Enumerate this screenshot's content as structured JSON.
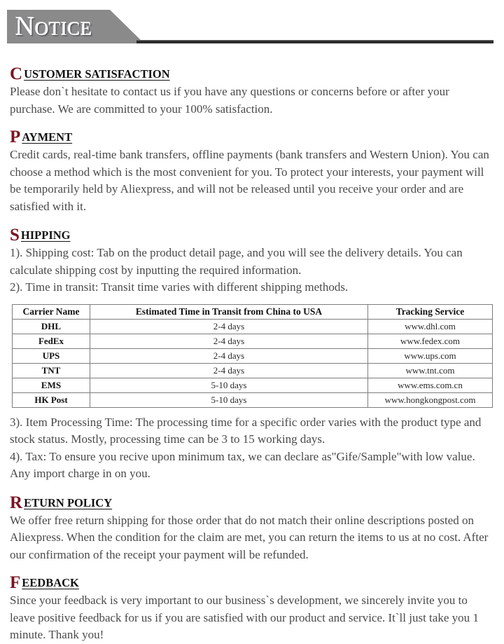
{
  "banner": {
    "title": "Notice"
  },
  "sections": [
    {
      "id": "customer-satisfaction",
      "dropcap": "C",
      "heading_rest": "USTOMER SATISFACTION ",
      "paragraphs": [
        "Please don`t hesitate to contact us if you have any questions or concerns before or after your purchase. We are committed to your 100% satisfaction."
      ]
    },
    {
      "id": "payment",
      "dropcap": "P",
      "heading_rest": "AYMENT",
      "paragraphs": [
        "Credit cards, real-time bank transfers, offline payments (bank transfers and Western Union). You can choose a method which is the most convenient for you. To protect your interests, your payment will be temporarily held by Aliexpress, and will not be released until you receive your order and are satisfied with it."
      ]
    },
    {
      "id": "shipping",
      "dropcap": "S",
      "heading_rest": "HIPPING",
      "paragraphs_before_table": [
        "1). Shipping cost:  Tab on the product detail page, and you will see the delivery details. You can calculate shipping cost by inputting the required information.",
        "2). Time in transit: Transit time varies with different shipping methods."
      ],
      "paragraphs_after_table": [
        "3). Item Processing Time: The processing time for a specific order varies with the product type and stock status. Mostly, processing time can be 3 to 15 working days.",
        "4). Tax: To ensure you recive upon minimum tax, we can declare as\"Gife/Sample\"with low value. Any import charge in on you."
      ]
    },
    {
      "id": "return-policy",
      "dropcap": "R",
      "heading_rest": "ETURN POLICY",
      "paragraphs": [
        "We offer free return shipping for those order that do not match their online descriptions posted on Aliexpress. When the condition for the claim are met, you can return the items to us at no cost. After our confirmation of the receipt your payment will be refunded."
      ]
    },
    {
      "id": "feedback",
      "dropcap": "F",
      "heading_rest": "EEDBACK",
      "paragraphs": [
        "Since your feedback is very important to our business`s development, we sincerely invite you to leave positive feedback for us if you are satisfied with our product and service. It`ll just take you 1 minute. Thank you!"
      ]
    }
  ],
  "shipping_table": {
    "headers": [
      "Carrier Name",
      "Estimated Time in Transit from China to USA",
      "Tracking Service"
    ],
    "rows": [
      {
        "carrier": "DHL",
        "transit": "2-4 days",
        "tracking": "www.dhl.com"
      },
      {
        "carrier": "FedEx",
        "transit": "2-4 days",
        "tracking": "www.fedex.com"
      },
      {
        "carrier": "UPS",
        "transit": "2-4 days",
        "tracking": "www.ups.com"
      },
      {
        "carrier": "TNT",
        "transit": "2-4 days",
        "tracking": "www.tnt.com"
      },
      {
        "carrier": "EMS",
        "transit": "5-10 days",
        "tracking": "www.ems.com.cn"
      },
      {
        "carrier": "HK Post",
        "transit": "5-10 days",
        "tracking": "www.hongkongpost.com"
      }
    ]
  },
  "colors": {
    "dropcap": "#7a1420",
    "banner_fill": "#8a8a8a",
    "banner_text": "#ffffff",
    "body_text": "#4a4a4a",
    "rule": "#2d2d2d",
    "table_border": "#7d7d7d"
  }
}
